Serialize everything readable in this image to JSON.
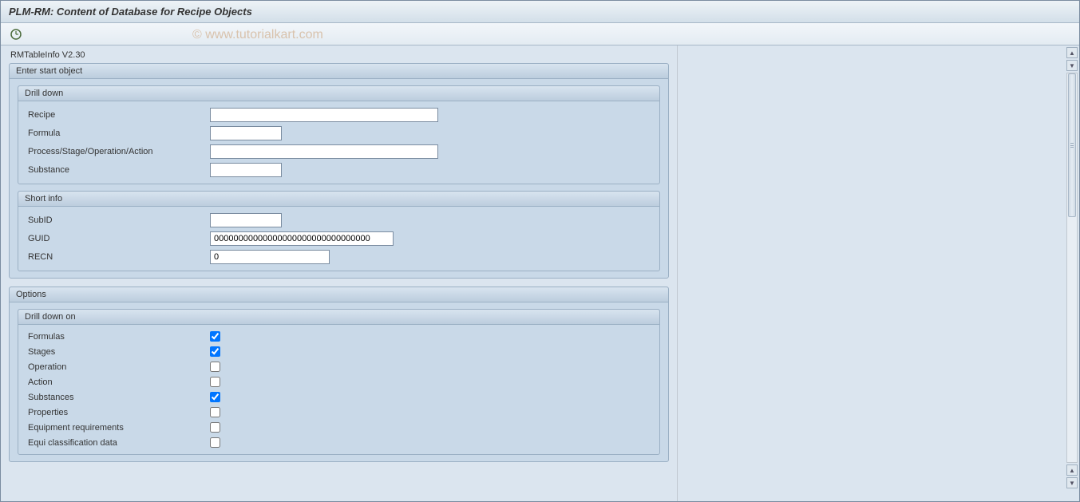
{
  "title": "PLM-RM: Content of Database for Recipe Objects",
  "watermark": "© www.tutorialkart.com",
  "version_label": "RMTableInfo V2.30",
  "enter_start": {
    "header": "Enter start object",
    "drill_down": {
      "header": "Drill down",
      "fields": {
        "recipe": {
          "label": "Recipe",
          "value": ""
        },
        "formula": {
          "label": "Formula",
          "value": ""
        },
        "psoa": {
          "label": "Process/Stage/Operation/Action",
          "value": ""
        },
        "substance": {
          "label": "Substance",
          "value": ""
        }
      }
    },
    "short_info": {
      "header": "Short info",
      "fields": {
        "subid": {
          "label": "SubID",
          "value": ""
        },
        "guid": {
          "label": "GUID",
          "value": "00000000000000000000000000000000"
        },
        "recn": {
          "label": "RECN",
          "value": "0"
        }
      }
    }
  },
  "options": {
    "header": "Options",
    "drill_down_on": {
      "header": "Drill down on",
      "checks": {
        "formulas": {
          "label": "Formulas",
          "checked": true
        },
        "stages": {
          "label": "Stages",
          "checked": true
        },
        "operation": {
          "label": "Operation",
          "checked": false
        },
        "action_": {
          "label": "Action",
          "checked": false
        },
        "substances": {
          "label": "Substances",
          "checked": true
        },
        "properties": {
          "label": "Properties",
          "checked": false
        },
        "equipreq": {
          "label": "Equipment requirements",
          "checked": false
        },
        "equiclass": {
          "label": "Equi classification data",
          "checked": false
        }
      }
    }
  }
}
